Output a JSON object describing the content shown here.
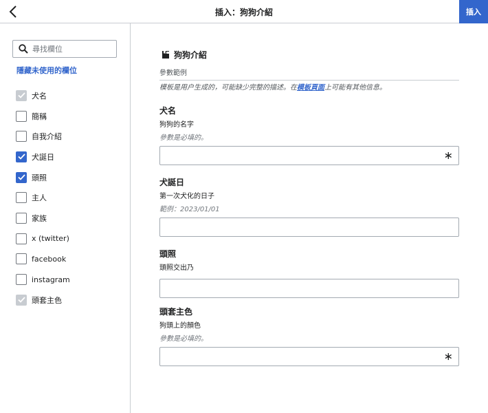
{
  "header": {
    "title": "插入：狗狗介紹",
    "insert_label": "插入"
  },
  "sidebar": {
    "search_placeholder": "尋找欄位",
    "hide_unused_label": "隱藏未使用的欄位",
    "fields": [
      {
        "label": "犬名",
        "state": "disabled"
      },
      {
        "label": "簡稱",
        "state": "unchecked"
      },
      {
        "label": "自我介紹",
        "state": "unchecked"
      },
      {
        "label": "犬誕日",
        "state": "checked"
      },
      {
        "label": "頭照",
        "state": "checked"
      },
      {
        "label": "主人",
        "state": "unchecked"
      },
      {
        "label": "家族",
        "state": "unchecked"
      },
      {
        "label": "x (twitter)",
        "state": "unchecked"
      },
      {
        "label": "facebook",
        "state": "unchecked"
      },
      {
        "label": "instagram",
        "state": "unchecked"
      },
      {
        "label": "頭套主色",
        "state": "disabled"
      }
    ]
  },
  "main": {
    "template_title": "狗狗介紹",
    "template_desc": "參數範例",
    "note_prefix": "模板是用户生成的，可能缺少完整的描述。在",
    "note_link": "模板頁面",
    "note_suffix": "上可能有其他信息。",
    "required_mark": "∗",
    "params": [
      {
        "name": "犬名",
        "desc": "狗狗的名字",
        "meta": "參數是必填的。",
        "value": "",
        "required": true
      },
      {
        "name": "犬誕日",
        "desc": "第一次犬化的日子",
        "meta": "範例：2023/01/01",
        "value": "",
        "required": false
      },
      {
        "name": "頭照",
        "desc": "頭照交出乃",
        "meta": "",
        "value": "",
        "required": false
      },
      {
        "name": "頭套主色",
        "desc": "狗頭上的顏色",
        "meta": "參數是必填的。",
        "value": "",
        "required": true
      }
    ]
  },
  "colors": {
    "accent": "#3366cc",
    "border": "#c8ccd1",
    "disabled": "#c8ccd1"
  },
  "icons": {
    "back": "chevron-left-icon",
    "search": "search-icon",
    "puzzle": "puzzle-icon",
    "check": "check-icon"
  }
}
